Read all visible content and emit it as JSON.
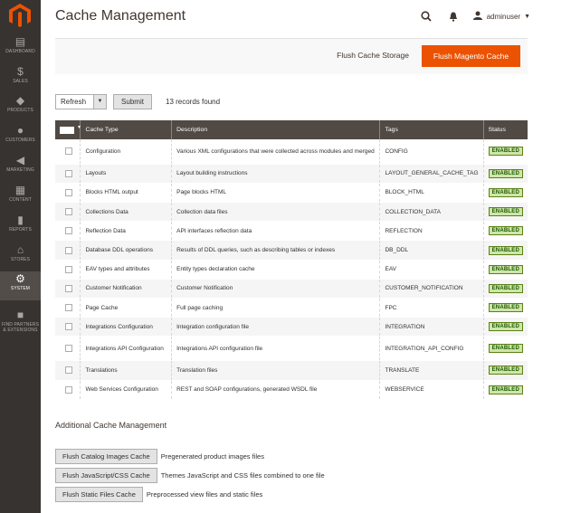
{
  "sidebar": {
    "items": [
      {
        "label": "DASHBOARD",
        "icon": "dashboard-icon",
        "glyph": "▤"
      },
      {
        "label": "SALES",
        "icon": "dollar-icon",
        "glyph": "$"
      },
      {
        "label": "PRODUCTS",
        "icon": "cube-icon",
        "glyph": "◆"
      },
      {
        "label": "CUSTOMERS",
        "icon": "person-icon",
        "glyph": "●"
      },
      {
        "label": "MARKETING",
        "icon": "megaphone-icon",
        "glyph": "◀"
      },
      {
        "label": "CONTENT",
        "icon": "content-icon",
        "glyph": "▦"
      },
      {
        "label": "REPORTS",
        "icon": "bar-chart-icon",
        "glyph": "▮"
      },
      {
        "label": "STORES",
        "icon": "store-icon",
        "glyph": "⌂"
      },
      {
        "label": "SYSTEM",
        "icon": "gear-icon",
        "glyph": "⚙"
      },
      {
        "label": "FIND PARTNERS & EXTENSIONS",
        "icon": "puzzle-icon",
        "glyph": "■"
      }
    ],
    "active": "SYSTEM"
  },
  "page": {
    "title": "Cache Management"
  },
  "header": {
    "user": "adminuser"
  },
  "actions": {
    "flush_storage": "Flush Cache Storage",
    "flush_magento": "Flush Magento Cache"
  },
  "mass_action": {
    "selected": "Refresh",
    "submit": "Submit",
    "records": "13 records found"
  },
  "grid": {
    "columns": [
      "Cache Type",
      "Description",
      "Tags",
      "Status"
    ],
    "rows": [
      {
        "type": "Configuration",
        "desc": "Various XML configurations that were collected across modules and merged",
        "tags": "CONFIG",
        "status": "ENABLED"
      },
      {
        "type": "Layouts",
        "desc": "Layout building instructions",
        "tags": "LAYOUT_GENERAL_CACHE_TAG",
        "status": "ENABLED"
      },
      {
        "type": "Blocks HTML output",
        "desc": "Page blocks HTML",
        "tags": "BLOCK_HTML",
        "status": "ENABLED"
      },
      {
        "type": "Collections Data",
        "desc": "Collection data files",
        "tags": "COLLECTION_DATA",
        "status": "ENABLED"
      },
      {
        "type": "Reflection Data",
        "desc": "API interfaces reflection data",
        "tags": "REFLECTION",
        "status": "ENABLED"
      },
      {
        "type": "Database DDL operations",
        "desc": "Results of DDL queries, such as describing tables or indexes",
        "tags": "DB_DDL",
        "status": "ENABLED"
      },
      {
        "type": "EAV types and attributes",
        "desc": "Entity types declaration cache",
        "tags": "EAV",
        "status": "ENABLED"
      },
      {
        "type": "Customer Notification",
        "desc": "Customer Notification",
        "tags": "CUSTOMER_NOTIFICATION",
        "status": "ENABLED"
      },
      {
        "type": "Page Cache",
        "desc": "Full page caching",
        "tags": "FPC",
        "status": "ENABLED"
      },
      {
        "type": "Integrations Configuration",
        "desc": "Integration configuration file",
        "tags": "INTEGRATION",
        "status": "ENABLED"
      },
      {
        "type": "Integrations API Configuration",
        "desc": "Integrations API configuration file",
        "tags": "INTEGRATION_API_CONFIG",
        "status": "ENABLED"
      },
      {
        "type": "Translations",
        "desc": "Translation files",
        "tags": "TRANSLATE",
        "status": "ENABLED"
      },
      {
        "type": "Web Services Configuration",
        "desc": "REST and SOAP configurations, generated WSDL file",
        "tags": "WEBSERVICE",
        "status": "ENABLED"
      }
    ]
  },
  "additional": {
    "title": "Additional Cache Management",
    "items": [
      {
        "button": "Flush Catalog Images Cache",
        "desc": "Pregenerated product images files"
      },
      {
        "button": "Flush JavaScript/CSS Cache",
        "desc": "Themes JavaScript and CSS files combined to one file"
      },
      {
        "button": "Flush Static Files Cache",
        "desc": "Preprocessed view files and static files"
      }
    ]
  },
  "colors": {
    "sidebar": "#373330",
    "accent": "#eb5202",
    "grid_header": "#514943",
    "enabled_bg": "#d0e5a9"
  }
}
